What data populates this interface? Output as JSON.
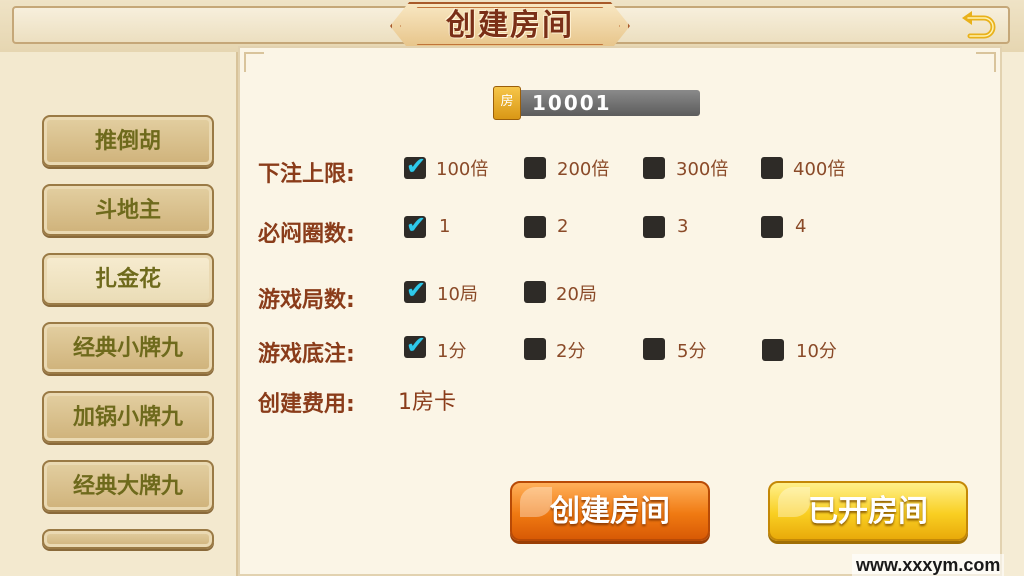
{
  "header": {
    "title": "创建房间",
    "back_icon": "back-arrow-icon"
  },
  "game_list": [
    {
      "label": "推倒胡",
      "active": false
    },
    {
      "label": "斗地主",
      "active": false
    },
    {
      "label": "扎金花",
      "active": true
    },
    {
      "label": "经典小牌九",
      "active": false
    },
    {
      "label": "加锅小牌九",
      "active": false
    },
    {
      "label": "经典大牌九",
      "active": false
    }
  ],
  "room": {
    "icon_label": "房",
    "number": "10001"
  },
  "settings": {
    "bet_limit": {
      "label": "下注上限:",
      "options": [
        "100倍",
        "200倍",
        "300倍",
        "400倍"
      ],
      "selected": 0
    },
    "must_stuff_rounds": {
      "label": "必闷圈数:",
      "options": [
        "1",
        "2",
        "3",
        "4"
      ],
      "selected": 0
    },
    "game_rounds": {
      "label": "游戏局数:",
      "options": [
        "10局",
        "20局"
      ],
      "selected": 0
    },
    "base_bet": {
      "label": "游戏底注:",
      "options": [
        "1分",
        "2分",
        "5分",
        "10分"
      ],
      "selected": 0
    },
    "cost": {
      "label": "创建费用:",
      "value": "1房卡"
    }
  },
  "actions": {
    "create_label": "创建房间",
    "opened_label": "已开房间"
  },
  "watermark": "www.xxxym.com",
  "colors": {
    "accent_orange": "#f07a12",
    "accent_yellow": "#f9cf22",
    "label_brown": "#8a3c1a",
    "check_cyan": "#2fc9ea"
  }
}
